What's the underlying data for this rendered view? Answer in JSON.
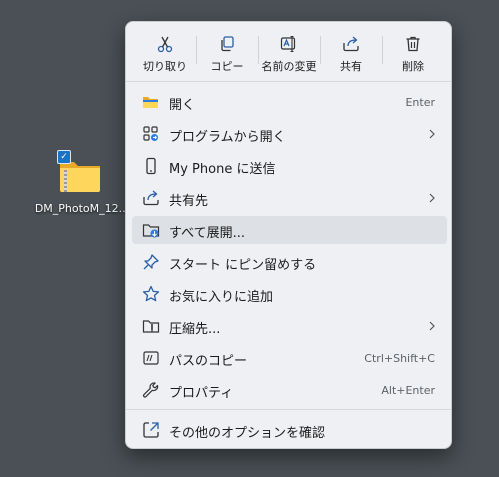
{
  "desktop": {
    "icon_label": "DM_PhotoM_12..."
  },
  "toolbar": {
    "cut": "切り取り",
    "copy": "コピー",
    "rename": "名前の変更",
    "share": "共有",
    "delete": "削除"
  },
  "menu": {
    "items": [
      {
        "label": "開く",
        "shortcut": "Enter",
        "icon": "folder-open-icon"
      },
      {
        "label": "プログラムから開く",
        "icon": "open-with-icon",
        "submenu": true
      },
      {
        "label": "My Phone に送信",
        "icon": "phone-icon"
      },
      {
        "label": "共有先",
        "icon": "share-icon",
        "submenu": true
      },
      {
        "label": "すべて展開...",
        "icon": "extract-all-icon",
        "highlighted": true
      },
      {
        "label": "スタート にピン留めする",
        "icon": "pin-icon"
      },
      {
        "label": "お気に入りに追加",
        "icon": "star-icon"
      },
      {
        "label": "圧縮先...",
        "icon": "compress-icon",
        "submenu": true
      },
      {
        "label": "パスのコピー",
        "shortcut": "Ctrl+Shift+C",
        "icon": "copy-path-icon"
      },
      {
        "label": "プロパティ",
        "shortcut": "Alt+Enter",
        "icon": "wrench-icon"
      }
    ],
    "more_options": {
      "label": "その他のオプションを確認",
      "icon": "more-options-icon"
    }
  }
}
